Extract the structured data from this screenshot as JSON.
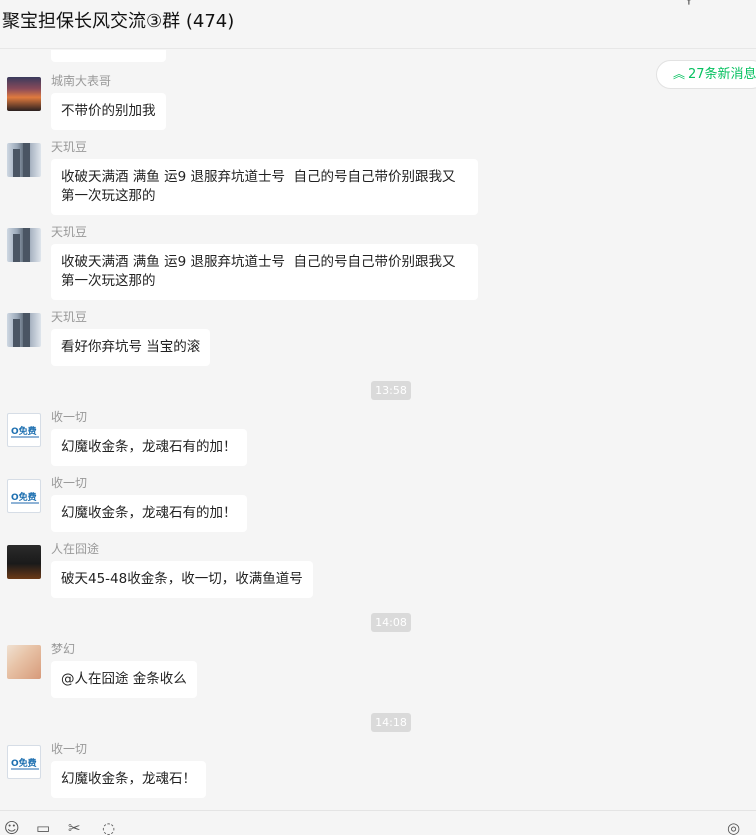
{
  "header": {
    "title": "聚宝担保长风交流③群 (474)",
    "pin_icon": "pin-icon",
    "minimize_icon": "minimize-icon"
  },
  "new_messages": {
    "label": "27条新消息",
    "icon": "double-chevron-up-icon",
    "color": "#07c160"
  },
  "messages": [
    {
      "sender": "城南大表哥",
      "text": "不带价的别加我",
      "avatar": "sunset-avatar"
    },
    {
      "sender": "天玑豆",
      "text": "收破天满酒 满鱼 运9 退服弃坑道士号  自己的号自己带价别跟我又第一次玩这那的",
      "avatar": "tower-avatar"
    },
    {
      "sender": "天玑豆",
      "text": "收破天满酒 满鱼 运9 退服弃坑道士号  自己的号自己带价别跟我又第一次玩这那的",
      "avatar": "tower-avatar"
    },
    {
      "sender": "天玑豆",
      "text": "看好你弃坑号 当宝的滚",
      "avatar": "tower-avatar"
    },
    {
      "time": "13:58"
    },
    {
      "sender": "收一切",
      "text": "幻魔收金条，龙魂石有的加！",
      "avatar": "logo-avatar"
    },
    {
      "sender": "收一切",
      "text": "幻魔收金条，龙魂石有的加！",
      "avatar": "logo-avatar"
    },
    {
      "sender": "人在囧途",
      "text": "破天45-48收金条，收一切，收满鱼道号",
      "avatar": "night-avatar"
    },
    {
      "time": "14:08"
    },
    {
      "sender": "梦幻",
      "text": "@人在囧途 金条收么",
      "avatar": "cute-avatar"
    },
    {
      "time": "14:18"
    },
    {
      "sender": "收一切",
      "text": "幻魔收金条，龙魂石！",
      "avatar": "logo-avatar"
    }
  ],
  "toolbar": {
    "icons": [
      "emoji-icon",
      "folder-icon",
      "scissors-icon",
      "chat-history-icon",
      "voice-call-icon"
    ]
  }
}
